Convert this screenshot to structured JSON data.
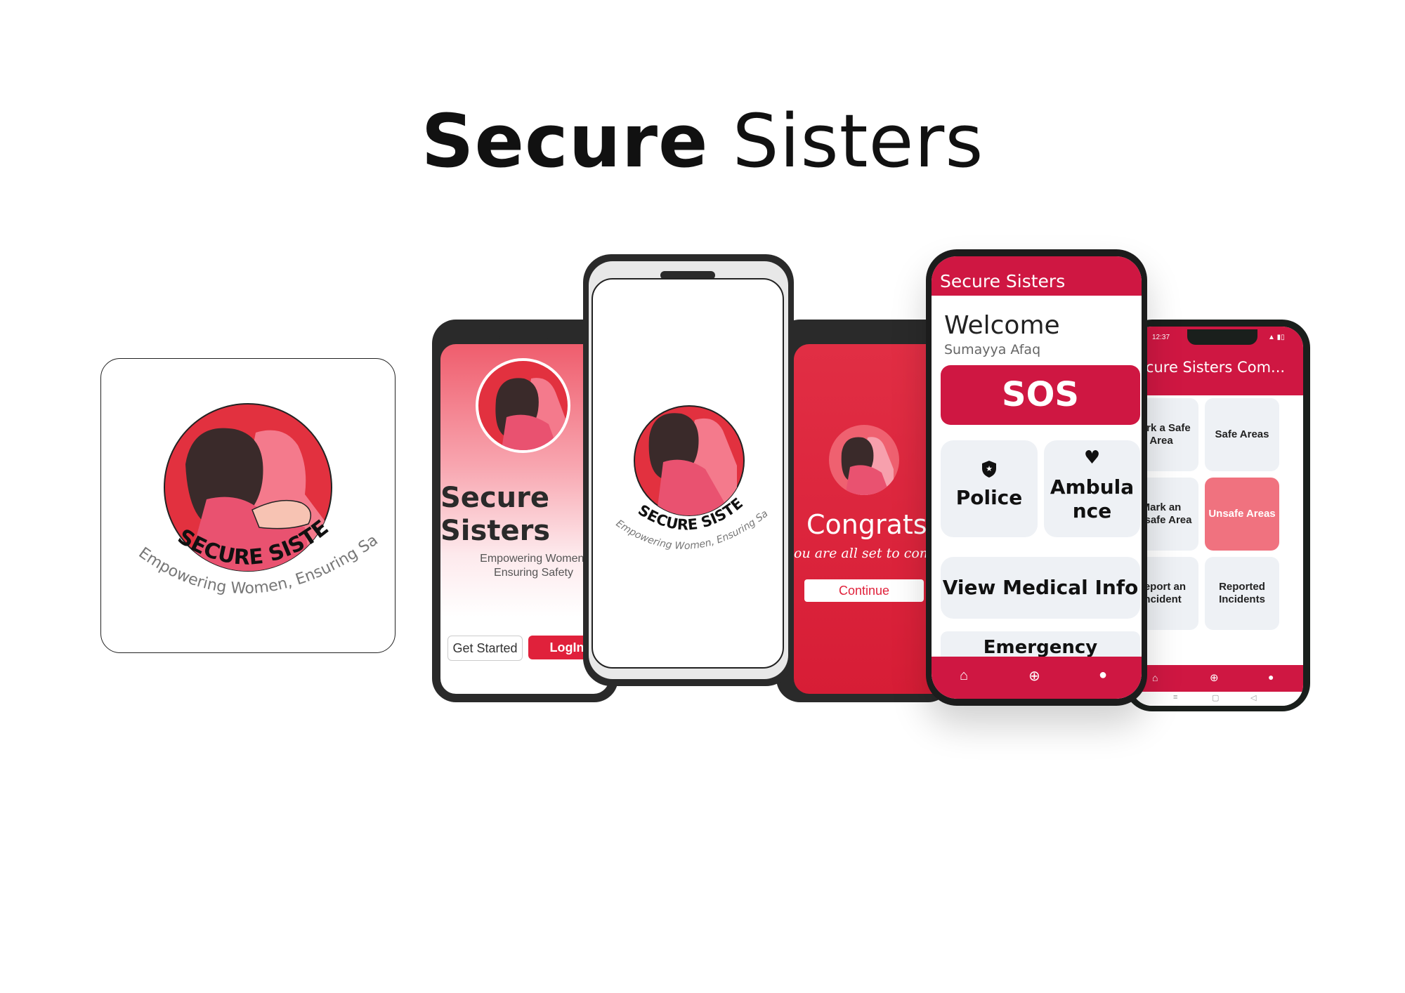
{
  "page": {
    "title_bold": "Secure",
    "title_light": "Sisters"
  },
  "logo": {
    "wordmark_bold": "SECURE",
    "wordmark_light": "SISTERS",
    "tagline": "Empowering Women, Ensuring Safety"
  },
  "screen_intro": {
    "title_line1": "Secure",
    "title_line2": "Sisters",
    "subtitle_line1": "Empowering Women,",
    "subtitle_line2": "Ensuring Safety",
    "get_started_label": "Get Started",
    "login_label": "LogIn"
  },
  "screen_splash": {
    "wordmark_bold": "SECURE",
    "wordmark_light": "SISTERS",
    "tagline": "Empowering Women, Ensuring Safety"
  },
  "screen_congrats": {
    "heading": "Congrats!",
    "message": "ou are all set to conti",
    "continue_label": "Continue"
  },
  "screen_home": {
    "app_title": "Secure Sisters",
    "welcome": "Welcome",
    "user_name": "Sumayya Afaq",
    "sos_label": "SOS",
    "police_label": "Police",
    "ambulance_line1": "Ambula",
    "ambulance_line2": "nce",
    "medical_label": "View Medical Info",
    "contacts_label": "Emergency Contacts",
    "nav": [
      "home-icon",
      "plus-circle-icon",
      "person-icon"
    ]
  },
  "screen_community": {
    "status_time": "12:37",
    "app_title": "ecure Sisters Com...",
    "tiles": [
      {
        "label": "Mark a Safe Area"
      },
      {
        "label": "Safe Areas"
      },
      {
        "label": "Mark an Unsafe Area"
      },
      {
        "label": "Unsafe Areas"
      },
      {
        "label": "Report an Incident"
      },
      {
        "label": "Reported Incidents"
      }
    ]
  },
  "colors": {
    "brand_red": "#cf1742",
    "accent_pink": "#f0727f",
    "card_gray": "#eef1f5"
  }
}
